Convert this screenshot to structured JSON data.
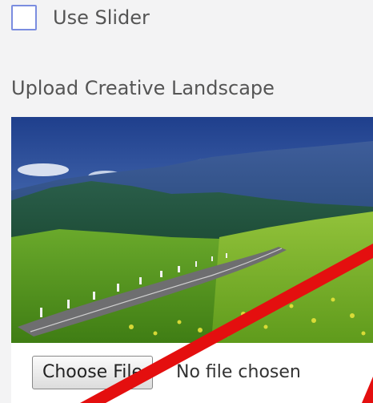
{
  "use_slider": {
    "label": "Use Slider",
    "checked": false
  },
  "upload": {
    "label": "Upload Creative Landscape",
    "button_label": "Choose File",
    "status_text": "No file chosen"
  },
  "colors": {
    "checkbox_border": "#7b8de0",
    "annotation_arrow": "#e40f0f"
  },
  "icons": {
    "annotation": "red-arrow-annotation"
  }
}
